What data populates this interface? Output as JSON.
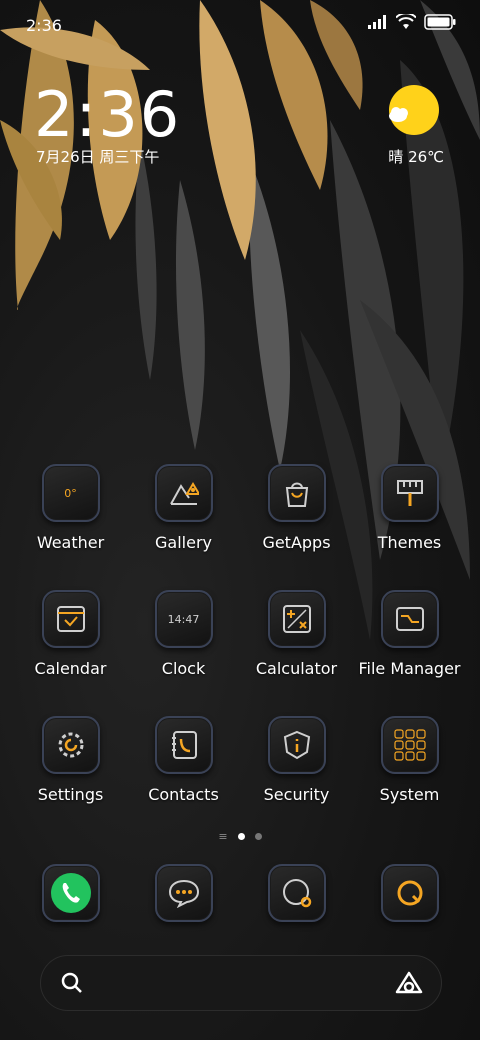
{
  "status_bar": {
    "time": "2:36"
  },
  "clock_widget": {
    "time": "2:36",
    "date": "7月26日 周三下午"
  },
  "weather_widget": {
    "condition_icon": "sun-cloud-icon",
    "label": "晴 26℃"
  },
  "apps": [
    {
      "label": "Weather",
      "icon": "weather-icon",
      "glyph": "0°"
    },
    {
      "label": "Gallery",
      "icon": "gallery-icon"
    },
    {
      "label": "GetApps",
      "icon": "getapps-icon"
    },
    {
      "label": "Themes",
      "icon": "themes-icon"
    },
    {
      "label": "Calendar",
      "icon": "calendar-icon"
    },
    {
      "label": "Clock",
      "icon": "clock-icon",
      "glyph": "14:47"
    },
    {
      "label": "Calculator",
      "icon": "calculator-icon"
    },
    {
      "label": "File Manager",
      "icon": "file-manager-icon"
    },
    {
      "label": "Settings",
      "icon": "settings-icon"
    },
    {
      "label": "Contacts",
      "icon": "contacts-icon"
    },
    {
      "label": "Security",
      "icon": "security-icon"
    },
    {
      "label": "System",
      "icon": "system-folder-icon"
    }
  ],
  "dock": [
    {
      "icon": "phone-icon"
    },
    {
      "icon": "messages-icon"
    },
    {
      "icon": "browser-icon"
    },
    {
      "icon": "music-icon"
    }
  ],
  "search": {
    "icon": "search-icon",
    "assistant_icon": "assistant-icon"
  },
  "colors": {
    "accent": "#f5a623",
    "tile_border": "#3a4256",
    "weather_sun": "#ffd21a",
    "phone_green": "#22c35e"
  }
}
